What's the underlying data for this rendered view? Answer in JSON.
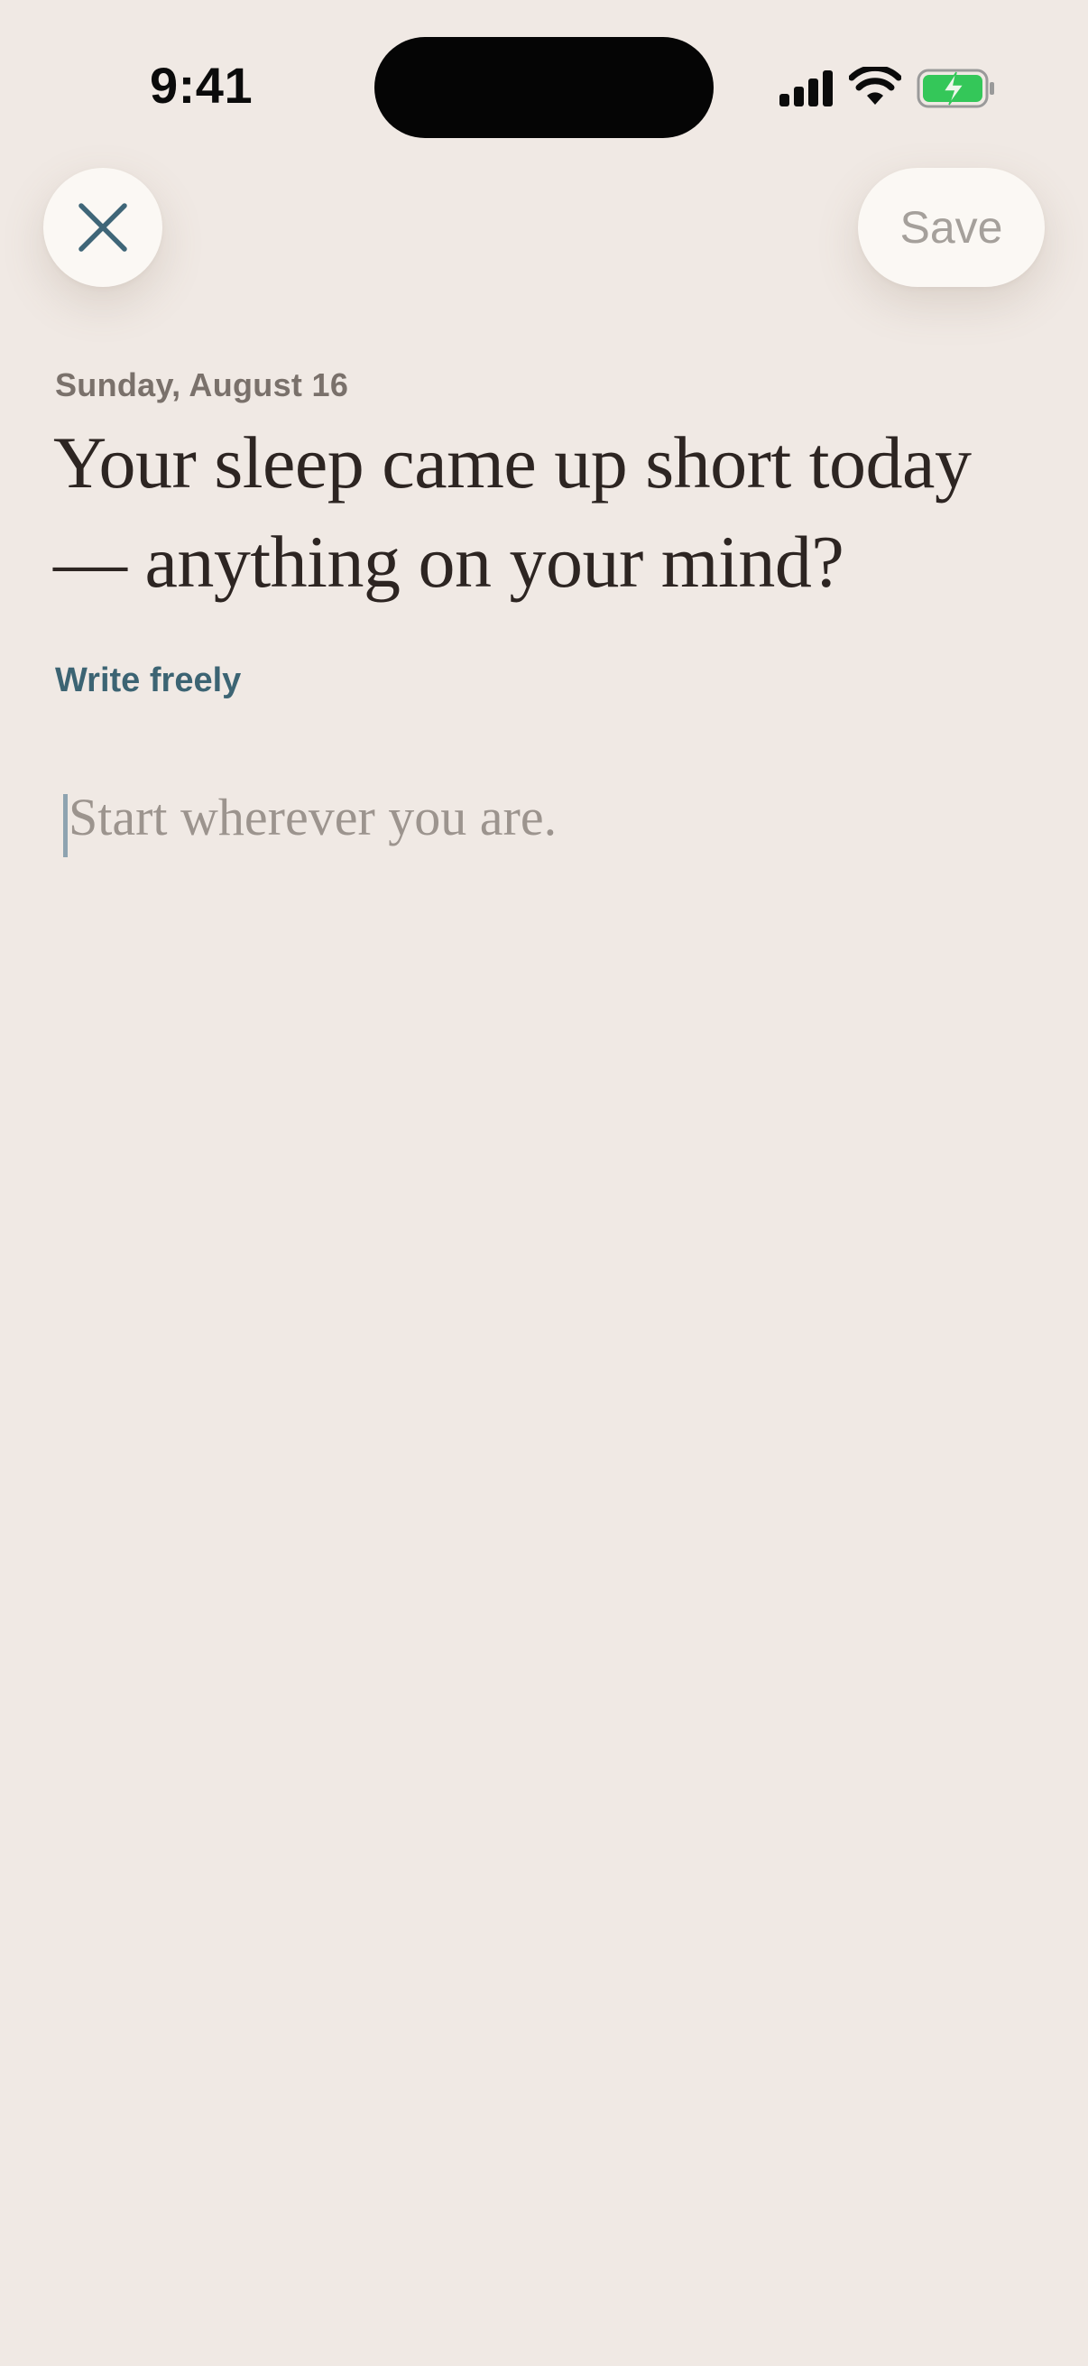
{
  "status_bar": {
    "time": "9:41",
    "icons": [
      "cellular-signal-icon",
      "wifi-icon",
      "battery-charging-icon"
    ],
    "battery_color": "#34c759"
  },
  "toolbar": {
    "close_icon": "close-icon",
    "save_label": "Save"
  },
  "entry": {
    "date": "Sunday, August 16",
    "prompt": "Your sleep came up short today — anything on your mind?",
    "mode_label": "Write freely",
    "placeholder": "Start wherever you are."
  },
  "colors": {
    "background": "#f0e9e4",
    "accent": "#3c6473",
    "title": "#2d2522",
    "muted": "#7a716b",
    "button_surface": "#fbf8f4"
  }
}
